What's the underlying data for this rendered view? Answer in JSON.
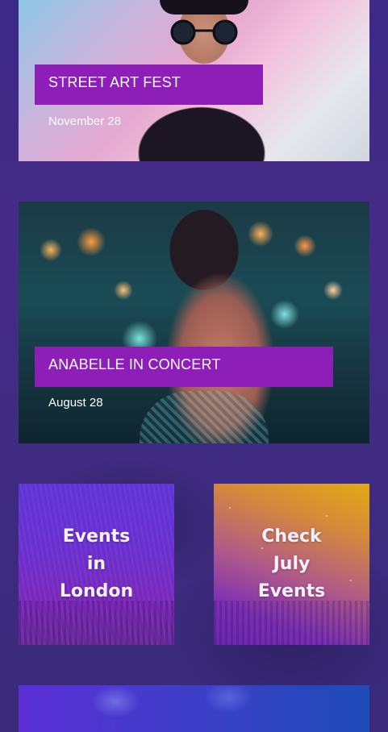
{
  "events": [
    {
      "title": "STREET ART FEST",
      "date": "November 28"
    },
    {
      "title": "ANABELLE IN CONCERT",
      "date": "August 28"
    }
  ],
  "tiles": [
    {
      "label": "Events\nin\nLondon"
    },
    {
      "label": "Check\nJuly\nEvents"
    }
  ],
  "colors": {
    "accent": "#8e1eb8",
    "background": "#452b87"
  }
}
